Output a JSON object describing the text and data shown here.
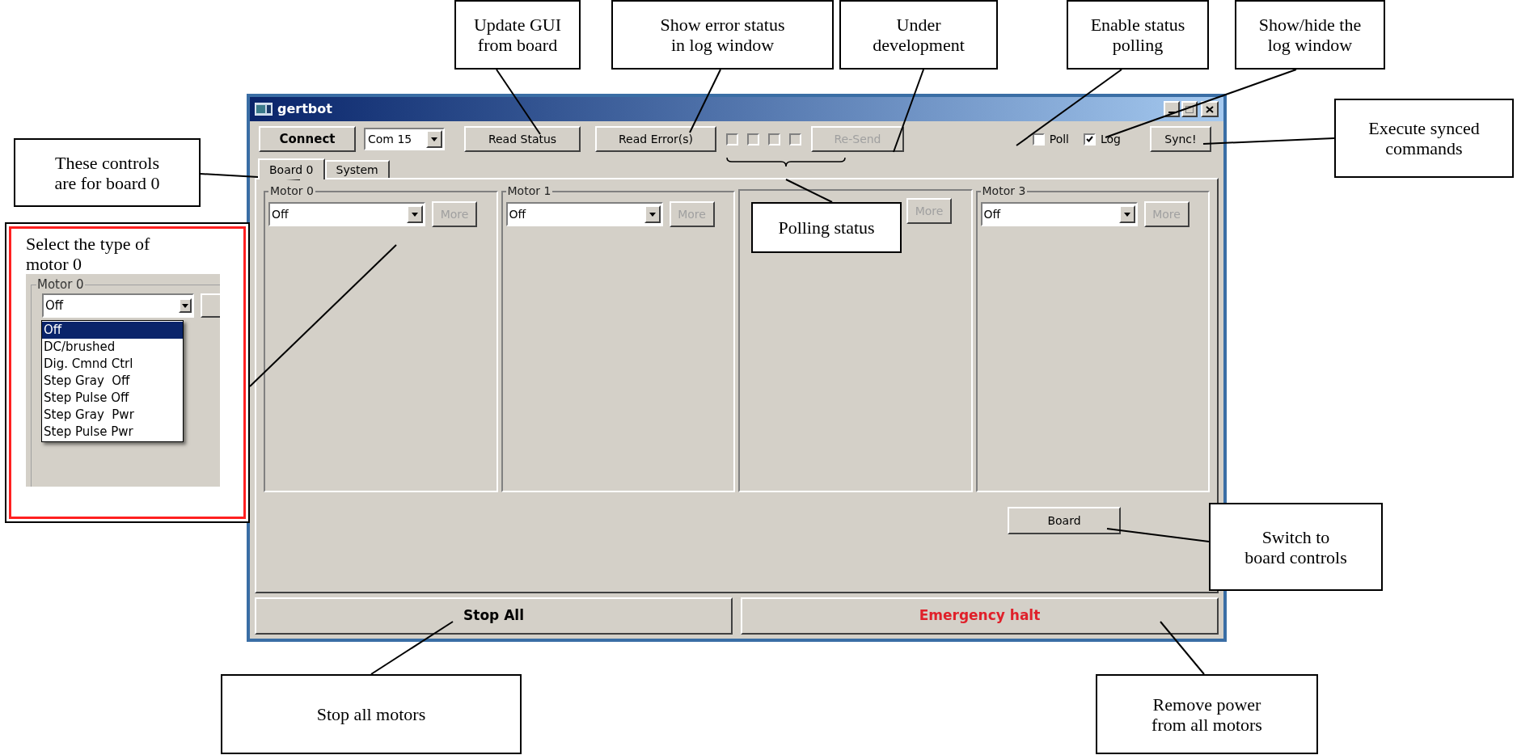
{
  "window": {
    "title": "gertbot"
  },
  "toolbar": {
    "connect": "Connect",
    "port": "Com 15",
    "read_status": "Read Status",
    "read_errors": "Read Error(s)",
    "status_boxes": [
      {
        "checked": false
      },
      {
        "checked": false
      },
      {
        "checked": false
      },
      {
        "checked": false
      }
    ],
    "resend": {
      "label": "Re-Send",
      "disabled": true
    },
    "poll": {
      "label": "Poll",
      "checked": false
    },
    "log": {
      "label": "Log",
      "checked": true
    },
    "sync": "Sync!"
  },
  "tabs": [
    {
      "label": "Board 0",
      "selected": true
    },
    {
      "label": "System",
      "selected": false
    }
  ],
  "motors": [
    {
      "title": "Motor 0",
      "type": "Off",
      "more": {
        "label": "More",
        "disabled": true
      }
    },
    {
      "title": "Motor 1",
      "type": "Off",
      "more": {
        "label": "More",
        "disabled": true
      }
    },
    {
      "more": {
        "label": "More",
        "disabled": true
      }
    },
    {
      "title": "Motor 3",
      "type": "Off",
      "more": {
        "label": "More",
        "disabled": true
      }
    }
  ],
  "board_button": "Board",
  "stop_all": "Stop All",
  "emergency_halt": "Emergency halt",
  "callouts": [
    {
      "lines": [
        "Update GUI",
        "from board"
      ]
    },
    {
      "lines": [
        "Show error status",
        "in log window"
      ]
    },
    {
      "lines": [
        "Under",
        "development"
      ]
    },
    {
      "lines": [
        "Enable status",
        "polling"
      ]
    },
    {
      "lines": [
        "Show/hide the",
        "log window"
      ]
    },
    {
      "lines": [
        "Execute synced",
        "commands"
      ]
    },
    {
      "lines": [
        "These controls",
        "are for board 0"
      ]
    },
    {
      "lines": [
        "Select the type of",
        "motor 0"
      ]
    },
    {
      "lines": [
        "Polling status"
      ]
    },
    {
      "lines": [
        "Switch to",
        "board controls"
      ]
    },
    {
      "lines": [
        "Stop all motors"
      ]
    },
    {
      "lines": [
        "Remove power",
        "from all motors"
      ]
    }
  ],
  "inset": {
    "group_title": "Motor 0",
    "value": "Off",
    "options": [
      {
        "label": "Off",
        "selected": true
      },
      {
        "label": "DC/brushed",
        "selected": false
      },
      {
        "label": "Dig. Cmnd Ctrl",
        "selected": false
      },
      {
        "label": "Step Gray  Off",
        "selected": false
      },
      {
        "label": "Step Pulse Off",
        "selected": false
      },
      {
        "label": "Step Gray  Pwr",
        "selected": false
      },
      {
        "label": "Step Pulse Pwr",
        "selected": false
      }
    ]
  }
}
